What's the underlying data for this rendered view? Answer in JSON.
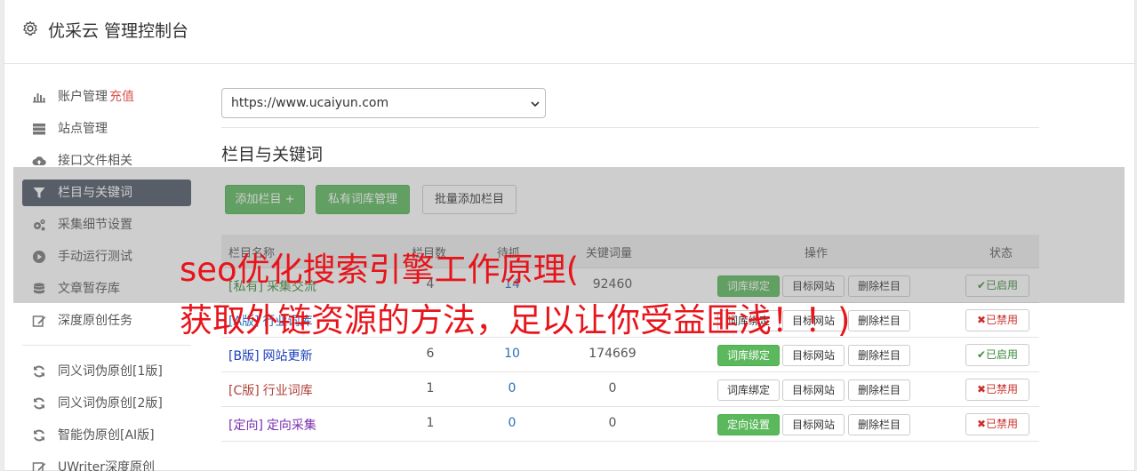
{
  "app": {
    "title": "优采云 管理控制台",
    "icon": "gear-icon"
  },
  "sidebar": {
    "items": [
      {
        "label": "账户管理",
        "extra": "充值",
        "icon": "bar-chart-icon"
      },
      {
        "label": "站点管理",
        "icon": "server-icon"
      },
      {
        "label": "接口文件相关",
        "icon": "cloud-upload-icon"
      },
      {
        "label": "栏目与关键词",
        "icon": "filter-icon",
        "active": true
      },
      {
        "label": "采集细节设置",
        "icon": "cogs-icon"
      },
      {
        "label": "手动运行测试",
        "icon": "play-circle-icon"
      },
      {
        "label": "文章暂存库",
        "icon": "database-icon"
      },
      {
        "label": "深度原创任务",
        "icon": "edit-icon"
      }
    ],
    "items2": [
      {
        "label": "同义词伪原创[1版]",
        "icon": "refresh-icon"
      },
      {
        "label": "同义词伪原创[2版]",
        "icon": "refresh-icon"
      },
      {
        "label": "智能伪原创[AI版]",
        "icon": "refresh-icon"
      },
      {
        "label": "UWriter深度原创",
        "icon": "edit-icon"
      }
    ]
  },
  "site_select": {
    "value": "https://www.ucaiyun.com"
  },
  "section": {
    "title": "栏目与关键词"
  },
  "toolbar": {
    "add_column": "添加栏目 +",
    "private_lib": "私有词库管理",
    "batch_add": "批量添加栏目"
  },
  "table": {
    "headers": {
      "name": "栏目名称",
      "cols": "栏目数",
      "wait": "待抓",
      "kw": "关键词量",
      "ops": "操作",
      "status": "状态"
    },
    "rows": [
      {
        "tag": "[私有]",
        "name": "采集交流",
        "cols": "4",
        "wait": "14",
        "kw": "92460",
        "op1": "词库绑定",
        "op1_green": true,
        "op2": "目标网站",
        "op3": "删除栏目",
        "status": "✔已启用",
        "enabled": true,
        "tag_color": "#3c8a3c"
      },
      {
        "tag": "[A版]",
        "name": "行业词库",
        "cols": "",
        "wait": "",
        "kw": "",
        "op1": "词库绑定",
        "op1_green": false,
        "op2": "目标网站",
        "op3": "删除栏目",
        "status": "✖已禁用",
        "enabled": false,
        "tag_color": "#2a6fb9"
      },
      {
        "tag": "[B版]",
        "name": "网站更新",
        "cols": "6",
        "wait": "10",
        "kw": "174669",
        "op1": "词库绑定",
        "op1_green": true,
        "op2": "目标网站",
        "op3": "删除栏目",
        "status": "✔已启用",
        "enabled": true,
        "tag_color": "#1a3fb8"
      },
      {
        "tag": "[C版]",
        "name": "行业词库",
        "cols": "1",
        "wait": "0",
        "kw": "0",
        "op1": "词库绑定",
        "op1_green": false,
        "op2": "目标网站",
        "op3": "删除栏目",
        "status": "✖已禁用",
        "enabled": false,
        "tag_color": "#b0403a"
      },
      {
        "tag": "[定向]",
        "name": "定向采集",
        "cols": "1",
        "wait": "0",
        "kw": "0",
        "op1": "定向设置",
        "op1_green": true,
        "op2": "目标网站",
        "op3": "删除栏目",
        "status": "✖已禁用",
        "enabled": false,
        "tag_color": "#7a2fb0"
      }
    ]
  },
  "watermark": {
    "line1": "seo优化搜索引擎工作原理(",
    "line2": "获取外链资源的方法，足以让你受益匪浅！！)"
  },
  "colors": {
    "accent_green": "#5cb85c",
    "sidebar_active": "#4d5563",
    "danger": "#d9534f",
    "watermark": "#e8141b"
  }
}
